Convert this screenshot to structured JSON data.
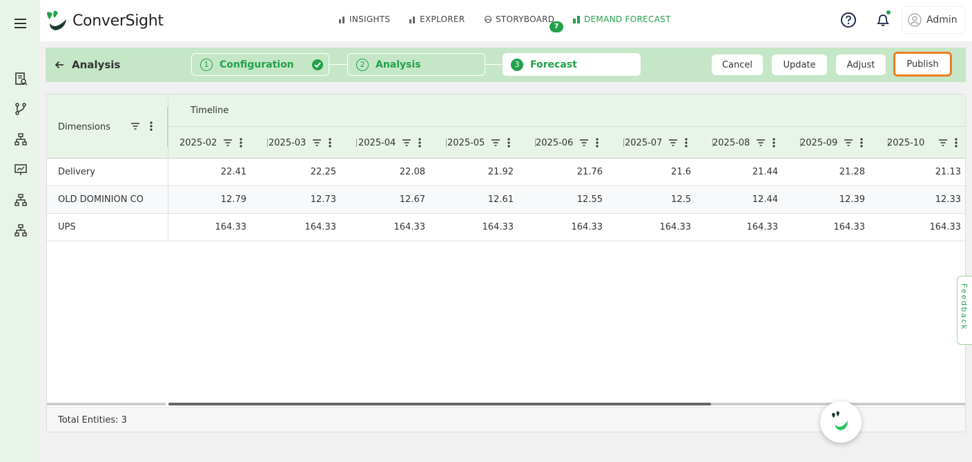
{
  "app": {
    "name": "ConverSight"
  },
  "nav": {
    "insights": "INSIGHTS",
    "explorer": "EXPLORER",
    "storyboard": "STORYBOARD",
    "storyboard_badge": "7",
    "demand_forecast": "DEMAND FORECAST"
  },
  "user": {
    "name": "Admin"
  },
  "header": {
    "back_label": "Analysis",
    "steps": [
      {
        "num": "1",
        "label": "Configuration"
      },
      {
        "num": "2",
        "label": "Analysis"
      },
      {
        "num": "3",
        "label": "Forecast"
      }
    ],
    "buttons": {
      "cancel": "Cancel",
      "update": "Update",
      "adjust": "Adjust",
      "publish": "Publish"
    }
  },
  "grid": {
    "dimensions_header": "Dimensions",
    "timeline_header": "Timeline",
    "columns": [
      "2025-02",
      "2025-03",
      "2025-04",
      "2025-05",
      "2025-06",
      "2025-07",
      "2025-08",
      "2025-09",
      "2025-10"
    ],
    "rows": [
      {
        "name": "Delivery",
        "values": [
          "22.41",
          "22.25",
          "22.08",
          "21.92",
          "21.76",
          "21.6",
          "21.44",
          "21.28",
          "21.13"
        ]
      },
      {
        "name": "OLD DOMINION CO",
        "values": [
          "12.79",
          "12.73",
          "12.67",
          "12.61",
          "12.55",
          "12.5",
          "12.44",
          "12.39",
          "12.33"
        ]
      },
      {
        "name": "UPS",
        "values": [
          "164.33",
          "164.33",
          "164.33",
          "164.33",
          "164.33",
          "164.33",
          "164.33",
          "164.33",
          "164.33"
        ]
      }
    ],
    "footer": "Total Entities: 3"
  },
  "feedback": "Feedback",
  "colors": {
    "brand_green": "#22a14a",
    "header_bg": "#c5e7c7",
    "publish_highlight": "#ef7d22"
  }
}
